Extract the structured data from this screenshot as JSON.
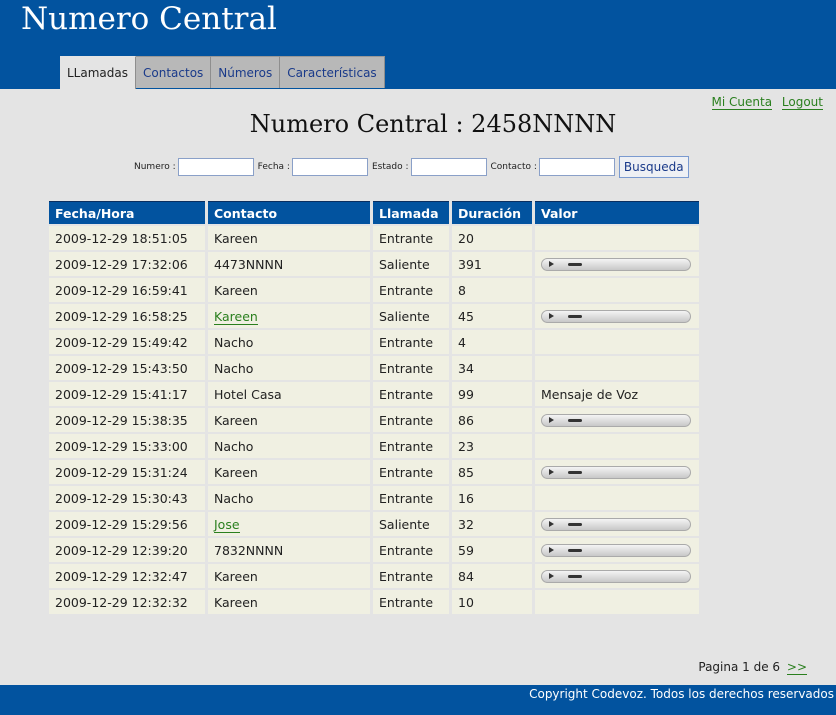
{
  "app": {
    "title": "Numero Central"
  },
  "tabs": [
    "LLamadas",
    "Contactos",
    "Números",
    "Características"
  ],
  "account": {
    "my_account": "Mi Cuenta",
    "logout": "Logout"
  },
  "page_title": "Numero Central : 2458NNNN",
  "search": {
    "numero_label": "Numero :",
    "fecha_label": "Fecha :",
    "estado_label": "Estado :",
    "contacto_label": "Contacto :",
    "button": "Busqueda"
  },
  "table": {
    "headers": [
      "Fecha/Hora",
      "Contacto",
      "Llamada",
      "Duración",
      "Valor"
    ],
    "rows": [
      {
        "fecha": "2009-12-29 18:51:05",
        "contacto": "Kareen",
        "link": false,
        "llamada": "Entrante",
        "duracion": "20",
        "valor": ""
      },
      {
        "fecha": "2009-12-29 17:32:06",
        "contacto": "4473NNNN",
        "link": false,
        "llamada": "Saliente",
        "duracion": "391",
        "valor": "player"
      },
      {
        "fecha": "2009-12-29 16:59:41",
        "contacto": "Kareen",
        "link": false,
        "llamada": "Entrante",
        "duracion": "8",
        "valor": ""
      },
      {
        "fecha": "2009-12-29 16:58:25",
        "contacto": "Kareen",
        "link": true,
        "llamada": "Saliente",
        "duracion": "45",
        "valor": "player"
      },
      {
        "fecha": "2009-12-29 15:49:42",
        "contacto": "Nacho",
        "link": false,
        "llamada": "Entrante",
        "duracion": "4",
        "valor": ""
      },
      {
        "fecha": "2009-12-29 15:43:50",
        "contacto": "Nacho",
        "link": false,
        "llamada": "Entrante",
        "duracion": "34",
        "valor": ""
      },
      {
        "fecha": "2009-12-29 15:41:17",
        "contacto": "Hotel Casa",
        "link": false,
        "llamada": "Entrante",
        "duracion": "99",
        "valor": "Mensaje de Voz"
      },
      {
        "fecha": "2009-12-29 15:38:35",
        "contacto": "Kareen",
        "link": false,
        "llamada": "Entrante",
        "duracion": "86",
        "valor": "player"
      },
      {
        "fecha": "2009-12-29 15:33:00",
        "contacto": "Nacho",
        "link": false,
        "llamada": "Entrante",
        "duracion": "23",
        "valor": ""
      },
      {
        "fecha": "2009-12-29 15:31:24",
        "contacto": "Kareen",
        "link": false,
        "llamada": "Entrante",
        "duracion": "85",
        "valor": "player"
      },
      {
        "fecha": "2009-12-29 15:30:43",
        "contacto": "Nacho",
        "link": false,
        "llamada": "Entrante",
        "duracion": "16",
        "valor": ""
      },
      {
        "fecha": "2009-12-29 15:29:56",
        "contacto": "Jose",
        "link": true,
        "llamada": "Saliente",
        "duracion": "32",
        "valor": "player"
      },
      {
        "fecha": "2009-12-29 12:39:20",
        "contacto": "7832NNNN",
        "link": false,
        "llamada": "Entrante",
        "duracion": "59",
        "valor": "player"
      },
      {
        "fecha": "2009-12-29 12:32:47",
        "contacto": "Kareen",
        "link": false,
        "llamada": "Entrante",
        "duracion": "84",
        "valor": "player"
      },
      {
        "fecha": "2009-12-29 12:32:32",
        "contacto": "Kareen",
        "link": false,
        "llamada": "Entrante",
        "duracion": "10",
        "valor": ""
      }
    ]
  },
  "pagination": {
    "text": "Pagina 1 de 6",
    "next": ">>"
  },
  "footer": {
    "copyright": "Copyright Codevoz. Todos los derechos reservados"
  },
  "colors": {
    "brand_blue": "#02539f",
    "link_green": "#2a7f1e",
    "row_bg": "#f0f0e2"
  },
  "icons": {
    "player_play": "play-icon",
    "player_bar": "seek-bar"
  }
}
